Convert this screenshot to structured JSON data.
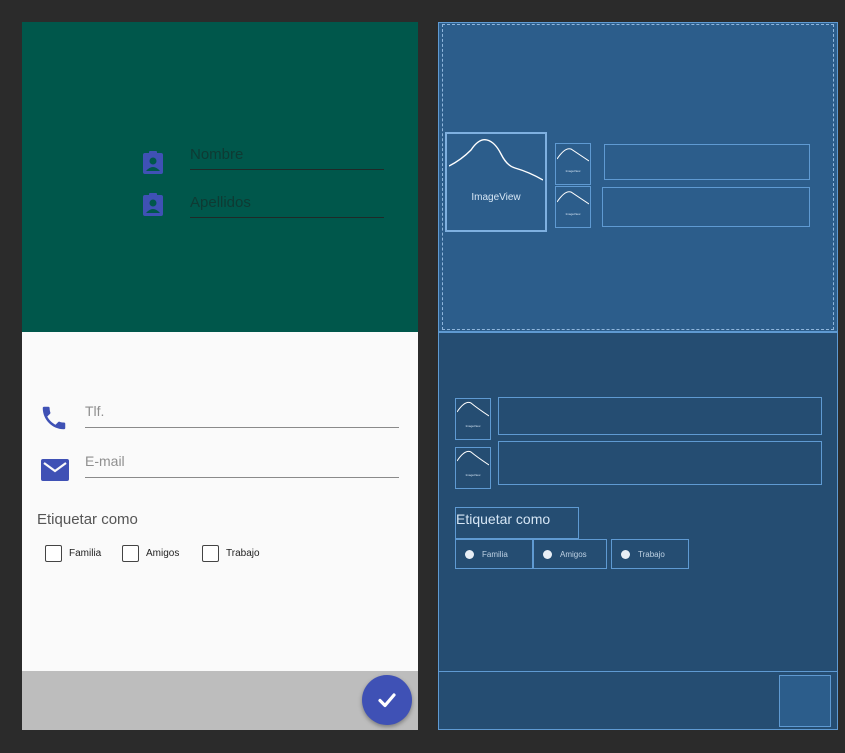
{
  "design": {
    "header": {
      "nombre_hint": "Nombre",
      "apellidos_hint": "Apellidos",
      "background_color": "#00574b"
    },
    "phone_hint": "Tlf.",
    "email_hint": "E-mail",
    "tag_label": "Etiquetar como",
    "checkboxes": [
      {
        "label": "Familia"
      },
      {
        "label": "Amigos"
      },
      {
        "label": "Trabajo"
      }
    ],
    "icons": {
      "contact": "contact-card-icon",
      "phone": "phone-icon",
      "email": "email-icon",
      "fab": "check-icon"
    },
    "accent_color": "#3f51b5"
  },
  "blueprint": {
    "imageview_label": "ImageView",
    "small_image_label": "ImageView",
    "tag_label": "Etiquetar como",
    "checkboxes": [
      {
        "label": "Familia"
      },
      {
        "label": "Amigos"
      },
      {
        "label": "Trabajo"
      }
    ],
    "background_color": "#254d72",
    "outline_color": "#5f9ad2"
  }
}
